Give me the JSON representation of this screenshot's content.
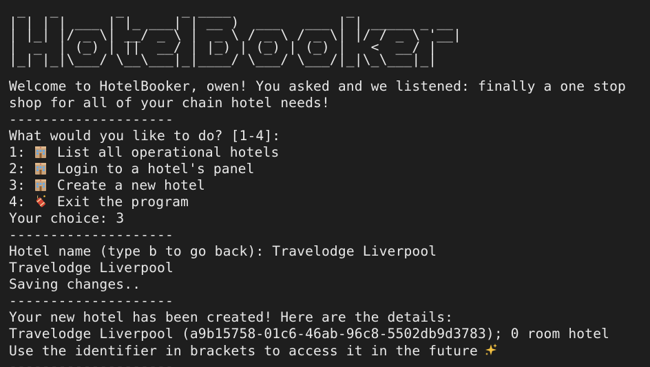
{
  "banner": {
    "lines": [
      " _   _       _       _ ____              _",
      "| | | | ___ | |_ ___| | __ )  ___   ___ | | _____ _ __",
      "| |_| |/ _ \\| __/ _ \\ |  _ \\ / _ \\ / _ \\| |/ / _ \\ '__|",
      "|  _  | (_) | ||  __/ | |_) | (_) | (_) |   <  __/ |",
      "|_| |_|\\___/ \\__\\___|_|____/ \\___/ \\___/|_|\\_\\___|_|"
    ]
  },
  "welcome": {
    "line1": "Welcome to HotelBooker, owen! You asked and we listened: finally a one stop",
    "line2": "shop for all of your chain hotel needs!"
  },
  "separator": "--------------------",
  "menu": {
    "prompt": "What would you like to do? [1-4]:",
    "items": [
      {
        "num": "1:",
        "icon": "hotel-icon",
        "label": "List all operational hotels"
      },
      {
        "num": "2:",
        "icon": "hotel-icon",
        "label": "Login to a hotel's panel"
      },
      {
        "num": "3:",
        "icon": "hotel-icon",
        "label": "Create a new hotel"
      },
      {
        "num": "4:",
        "icon": "firecracker-icon",
        "label": "Exit the program"
      }
    ],
    "choice_label": "Your choice: ",
    "choice_value": "3"
  },
  "create": {
    "prompt": "Hotel name (type b to go back): ",
    "input_value": "Travelodge Liverpool",
    "echo": "Travelodge Liverpool",
    "saving": "Saving changes.."
  },
  "result": {
    "created": "Your new hotel has been created! Here are the details:",
    "details": "Travelodge Liverpool (a9b15758-01c6-46ab-96c8-5502db9d3783); 0 room hotel",
    "note": "Use the identifier in brackets to access it in the future",
    "note_icon": "sparkles-icon"
  },
  "colors": {
    "background": "#1e1e1e",
    "text": "#e8e8e8"
  }
}
